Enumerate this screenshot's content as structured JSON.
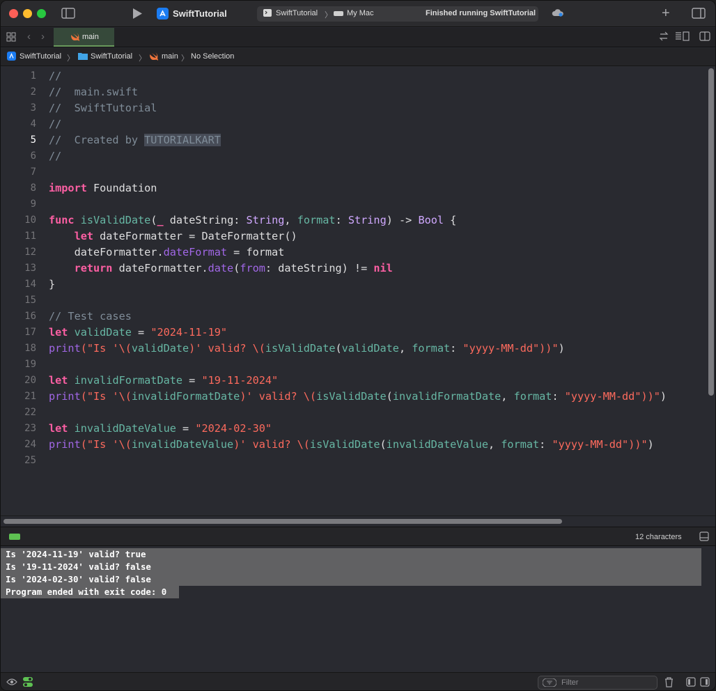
{
  "toolbar": {
    "app_title": "SwiftTutorial",
    "scheme": "SwiftTutorial",
    "separator": "〉",
    "destination": "My Mac",
    "status": "Finished running SwiftTutorial"
  },
  "tab": {
    "label": "main"
  },
  "breadcrumb": {
    "project": "SwiftTutorial",
    "folder": "SwiftTutorial",
    "file": "main",
    "selection": "No Selection",
    "sep": "〉"
  },
  "code": {
    "line_numbers": [
      "1",
      "2",
      "3",
      "4",
      "5",
      "6",
      "7",
      "8",
      "9",
      "10",
      "11",
      "12",
      "13",
      "14",
      "15",
      "16",
      "17",
      "18",
      "19",
      "20",
      "21",
      "22",
      "23",
      "24",
      "25"
    ],
    "current_line": 5,
    "l1": "//",
    "l2": "//  main.swift",
    "l3": "//  SwiftTutorial",
    "l4": "//",
    "l5_a": "//  Created by ",
    "l5_b": "TUTORIALKART",
    "l6": "//",
    "l8_kw": "import",
    "l8_rest": " Foundation",
    "l10": {
      "kw": "func",
      "name": "isValidDate",
      "p1": "(",
      "us": "_",
      "p2": " dateString: ",
      "t1": "String",
      "p3": ", ",
      "lbl": "format",
      "p4": ": ",
      "t2": "String",
      "p5": ") -> ",
      "t3": "Bool",
      "p6": " {"
    },
    "l11": {
      "ind": "    ",
      "kw": "let",
      "rest": " dateFormatter = DateFormatter()"
    },
    "l12": {
      "ind": "    ",
      "a": "dateFormatter.",
      "prop": "dateFormat",
      "b": " = format"
    },
    "l13": {
      "ind": "    ",
      "kw": "return",
      "a": " dateFormatter.",
      "m": "date",
      "b": "(",
      "lbl": "from",
      "c": ": dateString) != ",
      "nil": "nil"
    },
    "l14": "}",
    "l16": "// Test cases",
    "l17": {
      "kw": "let",
      "var": " validDate",
      "eq": " = ",
      "str": "\"2024-11-19\""
    },
    "l18": {
      "fn": "print",
      "s1": "(\"Is '\\(",
      "v": "validDate",
      "s2": ")' valid? \\(",
      "call": "isValidDate",
      "p1": "(",
      "v2": "validDate",
      "p2": ", ",
      "lbl": "format",
      "p3": ": ",
      "str": "\"yyyy-MM-dd\"",
      "s3": "))\"",
      "end": ")"
    },
    "l20": {
      "kw": "let",
      "var": " invalidFormatDate",
      "eq": " = ",
      "str": "\"19-11-2024\""
    },
    "l21": {
      "fn": "print",
      "s1": "(\"Is '\\(",
      "v": "invalidFormatDate",
      "s2": ")' valid? \\(",
      "call": "isValidDate",
      "p1": "(",
      "v2": "invalidFormatDate",
      "p2": ", ",
      "lbl": "format",
      "p3": ": ",
      "str": "\"yyyy-MM-dd\"",
      "s3": "))\"",
      "end": ")"
    },
    "l23": {
      "kw": "let",
      "var": " invalidDateValue",
      "eq": " = ",
      "str": "\"2024-02-30\""
    },
    "l24": {
      "fn": "print",
      "s1": "(\"Is '\\(",
      "v": "invalidDateValue",
      "s2": ")' valid? \\(",
      "call": "isValidDate",
      "p1": "(",
      "v2": "invalidDateValue",
      "p2": ", ",
      "lbl": "format",
      "p3": ": ",
      "str": "\"yyyy-MM-dd\"",
      "s3": "))\"",
      "end": ")"
    }
  },
  "debug": {
    "selection_count": "12 characters"
  },
  "console": {
    "lines": [
      "Is '2024-11-19' valid? true",
      "Is '19-11-2024' valid? false",
      "Is '2024-02-30' valid? false",
      "Program ended with exit code: 0"
    ]
  },
  "bottom": {
    "filter_placeholder": "Filter"
  },
  "colors": {
    "keyword": "#fc5fa3",
    "string": "#fc6a5d",
    "type": "#d0a8ff",
    "function": "#67b7a4",
    "comment": "#7f8c98",
    "property": "#a167e6"
  }
}
